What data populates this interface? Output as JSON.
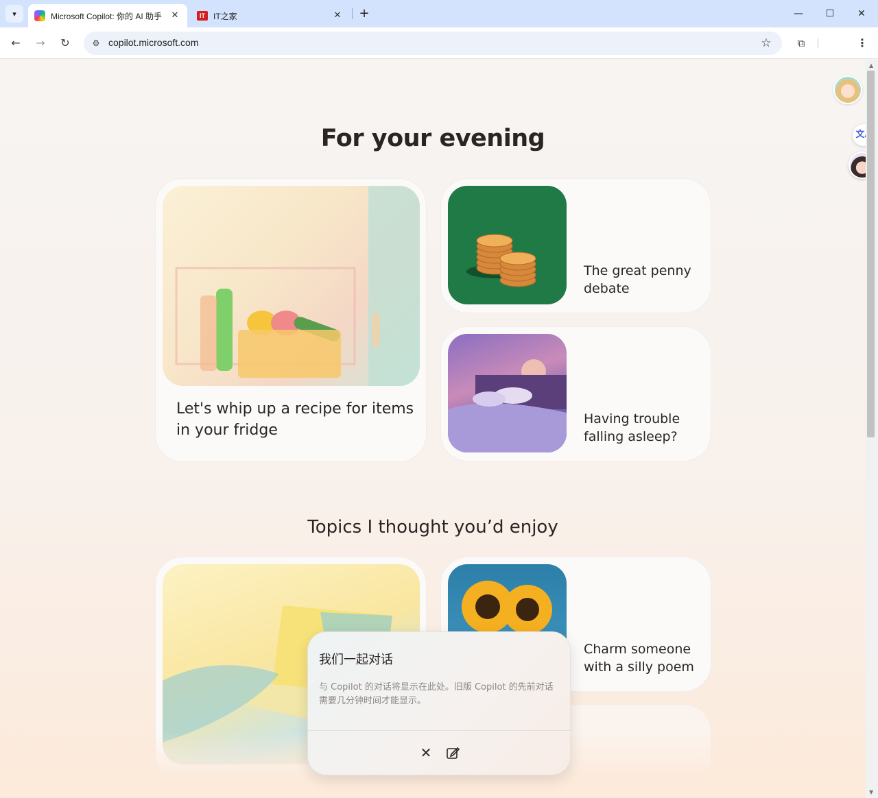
{
  "browser": {
    "tabs": [
      {
        "title": "Microsoft Copilot: 你的 AI 助手",
        "active": true
      },
      {
        "title": "IT之家",
        "active": false
      }
    ],
    "favicon_it_text": "IT",
    "url": "copilot.microsoft.com"
  },
  "page": {
    "heading_evening": "For your evening",
    "heading_topics": "Topics I thought you’d enjoy",
    "evening_cards": [
      {
        "text": "Let's whip up a recipe for items in your fridge",
        "image": "fridge-image"
      },
      {
        "text": "The great penny debate",
        "image": "coins-image"
      },
      {
        "text": "Having trouble falling asleep?",
        "image": "bed-image"
      }
    ],
    "topic_cards": [
      {
        "text": "",
        "image": "laptop-image"
      },
      {
        "text": "Charm someone with a silly poem",
        "image": "sunflower-image"
      }
    ],
    "side_translate_label": "文A"
  },
  "popup": {
    "title": "我们一起对话",
    "description": "与 Copilot 的对话将显示在此处。旧版 Copilot 的先前对话需要几分钟时间才能显示。",
    "close_icon": "close-icon",
    "new_chat_icon": "edit-icon"
  },
  "colors": {
    "tabbar": "#d3e3fd",
    "page_bg": "#f7f4f2",
    "coins_bg": "#1f7a46",
    "text": "#2a2522"
  }
}
